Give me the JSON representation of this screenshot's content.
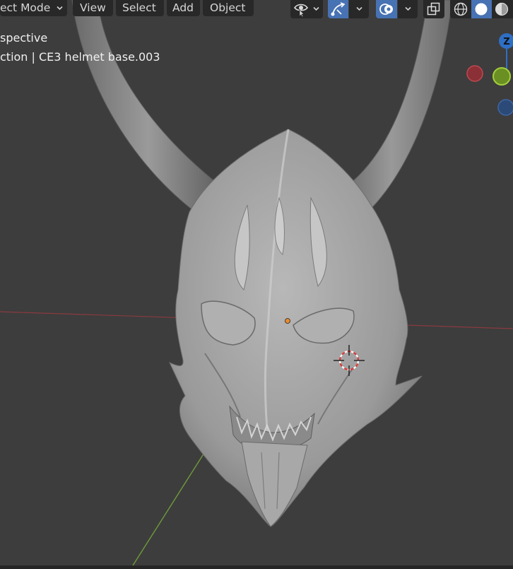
{
  "header": {
    "mode_label": "ect Mode",
    "menu": [
      "View",
      "Select",
      "Add",
      "Object"
    ]
  },
  "viewport": {
    "view_label": "spective",
    "collection_label": "ction | CE3 helmet base.003"
  },
  "gizmo": {
    "z_label": "Z"
  },
  "icons": {
    "visibility": "eye-icon",
    "gizmo_toggle": "gizmo-icon",
    "overlay_toggle": "overlay-icon",
    "xray": "xray-icon",
    "shading_wireframe": "wireframe-shading-icon",
    "shading_solid": "solid-shading-icon",
    "shading_material": "material-shading-icon"
  },
  "colors": {
    "background": "#3d3d3d",
    "accent": "#4772b3",
    "x_axis": "#9e3b44",
    "y_axis": "#6e9b3a",
    "z_axis": "#2e6fc5",
    "origin": "#e88b2e"
  }
}
